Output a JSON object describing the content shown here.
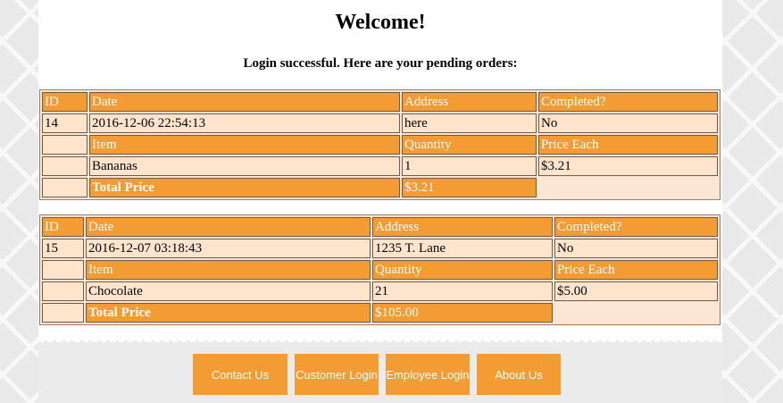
{
  "heading": "Welcome!",
  "subtitle": "Login successful. Here are your pending orders:",
  "headers": {
    "id": "ID",
    "date": "Date",
    "address": "Address",
    "completed": "Completed?",
    "item": "Item",
    "quantity": "Quantity",
    "price_each": "Price Each",
    "total_price": "Total Price"
  },
  "orders": [
    {
      "id": "14",
      "date": "2016-12-06 22:54:13",
      "address": "here",
      "completed": "No",
      "items": [
        {
          "name": "Bananas",
          "quantity": "1",
          "price_each": "$3.21"
        }
      ],
      "total": "$3.21"
    },
    {
      "id": "15",
      "date": "2016-12-07 03:18:43",
      "address": "1235 T. Lane",
      "completed": "No",
      "items": [
        {
          "name": "Chocolate",
          "quantity": "21",
          "price_each": "$5.00"
        }
      ],
      "total": "$105.00"
    }
  ],
  "nav": {
    "contact_us": "Contact Us",
    "customer_login": "Customer Login",
    "employee_login": "Employee Login",
    "about_us": "About Us"
  },
  "colors": {
    "accent": "#f39c33",
    "cell_bg": "#fee4cc",
    "page_bg": "#ffffff",
    "footer_bg": "#ebebeb"
  }
}
